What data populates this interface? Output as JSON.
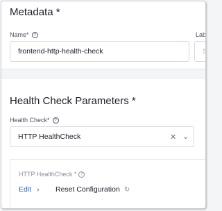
{
  "metadata": {
    "title": "Metadata *",
    "name_label": "Name*",
    "name_value": "frontend-http-health-check",
    "labels_label_partial": "Lab",
    "labels_value_partial": "S"
  },
  "health_check": {
    "title": "Health Check Parameters *",
    "type_label": "Health Check*",
    "type_value": "HTTP HealthCheck",
    "sub_label": "HTTP HealthCheck *",
    "edit_label": "Edit",
    "reset_label": "Reset Configuration"
  },
  "icons": {
    "help": "help-circle-icon",
    "clear": "close-icon",
    "dropdown": "chevron-down-icon",
    "edit_chevron": "chevron-right-icon",
    "reset": "refresh-icon"
  },
  "colors": {
    "link": "#2563c9",
    "background": "#f4f5f7",
    "card": "#ffffff"
  }
}
